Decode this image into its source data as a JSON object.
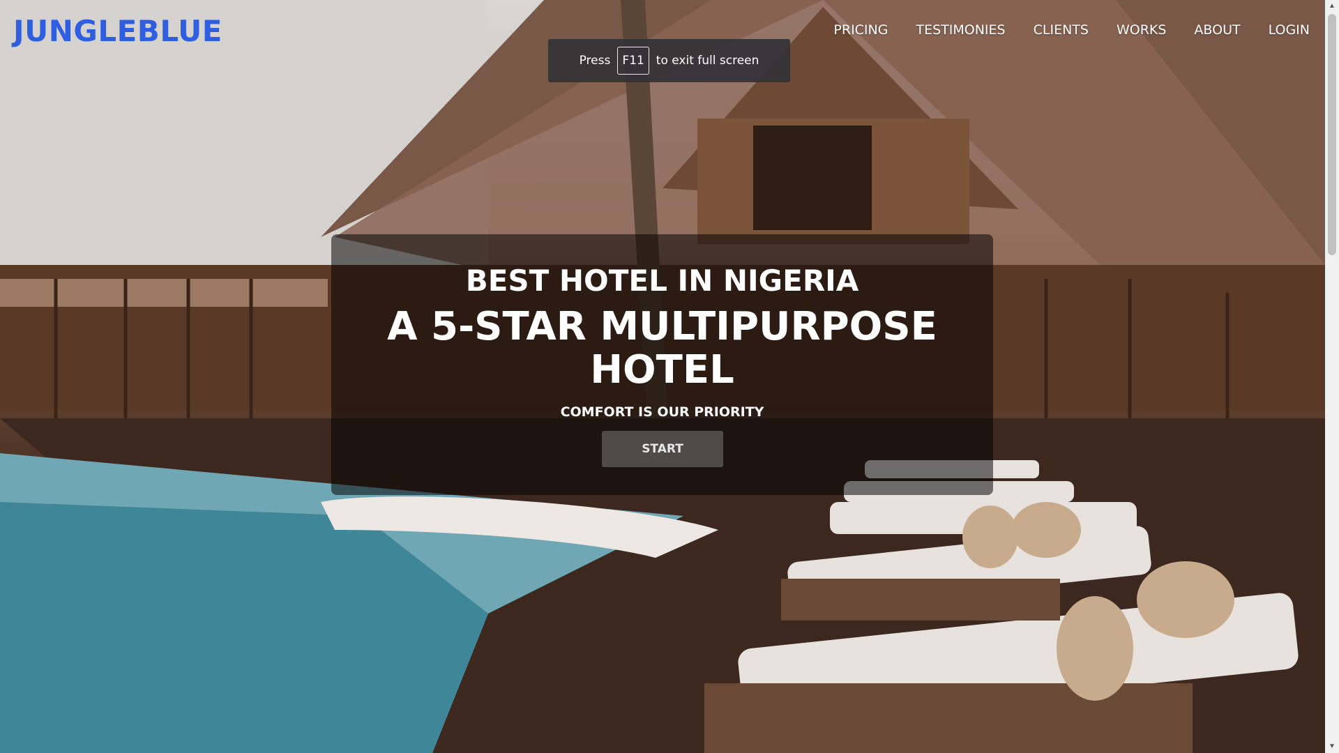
{
  "brand": {
    "logo": "JUNGLEBLUE"
  },
  "nav": {
    "items": [
      {
        "label": "PRICING"
      },
      {
        "label": "TESTIMONIES"
      },
      {
        "label": "CLIENTS"
      },
      {
        "label": "WORKS"
      },
      {
        "label": "ABOUT"
      },
      {
        "label": "LOGIN"
      }
    ]
  },
  "fullscreen_notice": {
    "prefix": "Press",
    "key": "F11",
    "suffix": "to exit full screen"
  },
  "hero": {
    "kicker": "BEST HOTEL IN NIGERIA",
    "title": "A 5-STAR MULTIPURPOSE HOTEL",
    "subtitle": "COMFORT IS OUR PRIORITY",
    "button": "START"
  },
  "colors": {
    "logo": "#2f5fe0",
    "overlay": "rgba(0,0,0,0.52)"
  },
  "scrollbar": {
    "position_fraction": 0
  }
}
